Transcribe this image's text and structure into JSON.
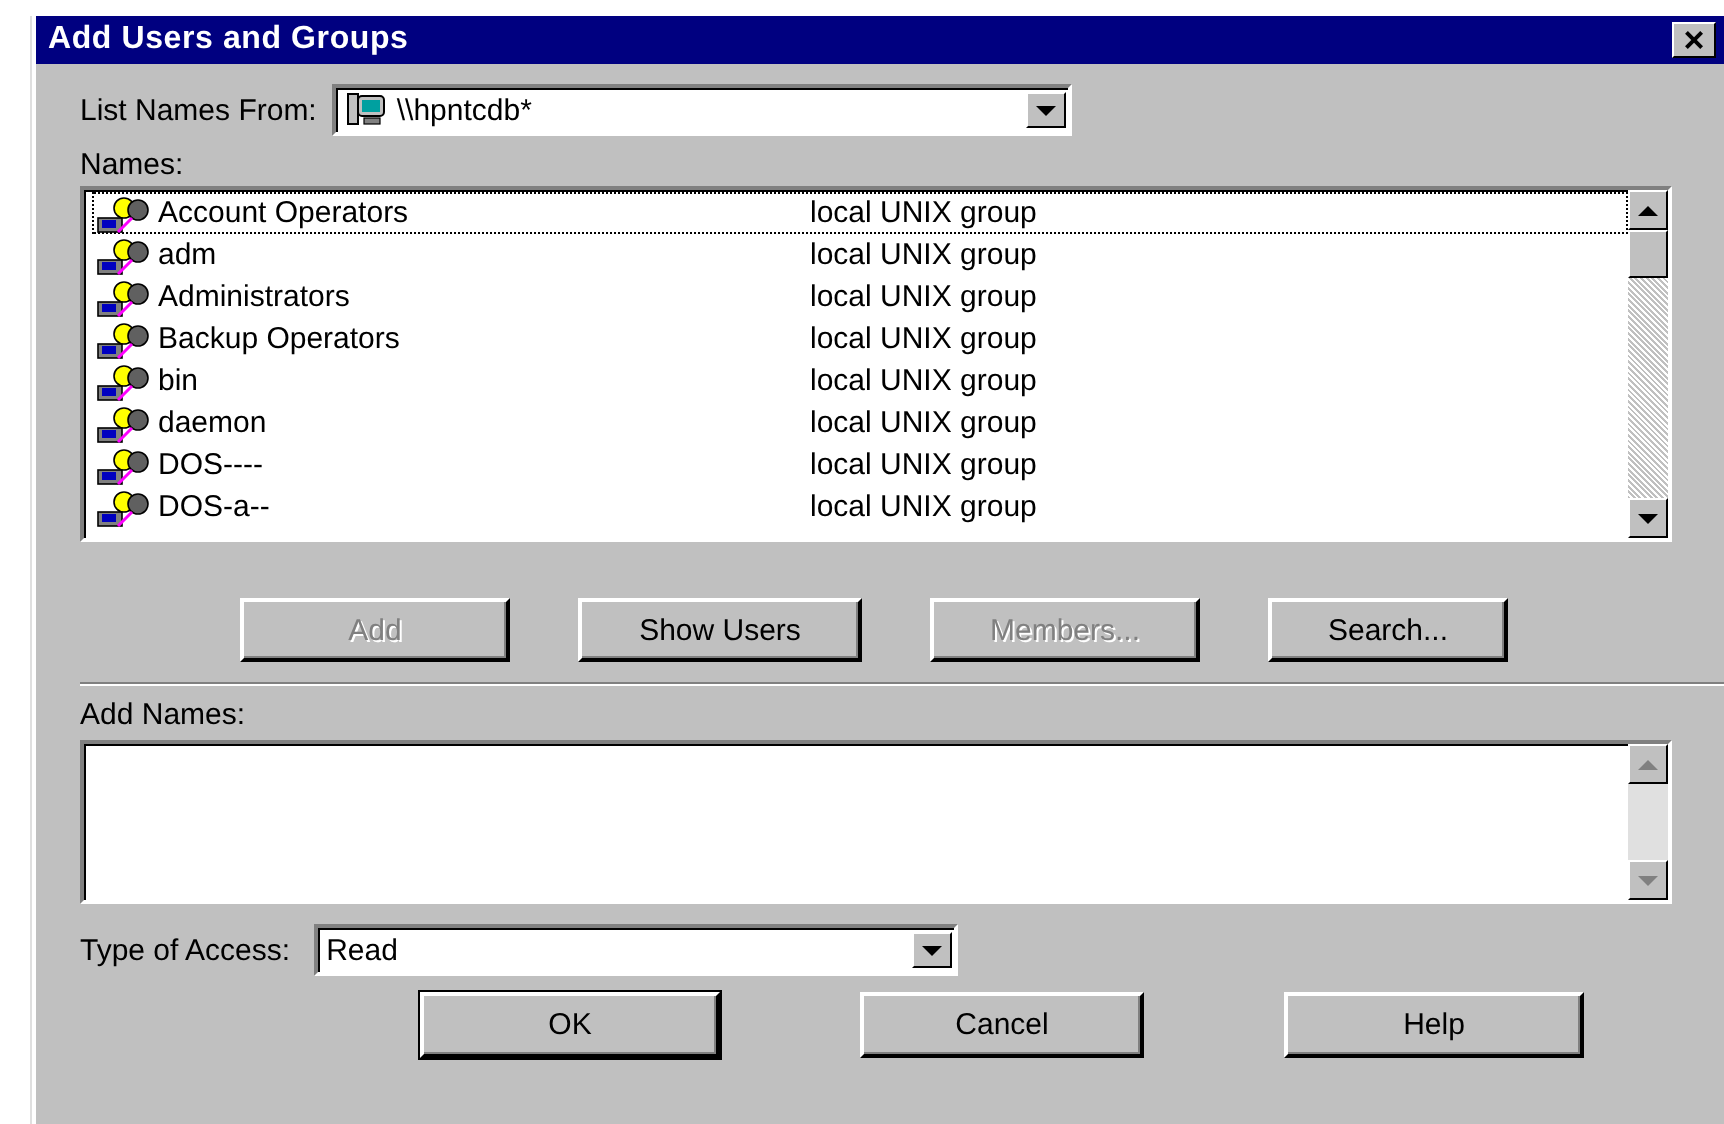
{
  "window": {
    "title": "Add Users and Groups",
    "close": "×"
  },
  "list_names_from": {
    "label": "List Names From:",
    "value": "\\\\hpntcdb*"
  },
  "names": {
    "label": "Names:",
    "rows": [
      {
        "name": "Account Operators",
        "type": "local UNIX group",
        "focused": true
      },
      {
        "name": "adm",
        "type": "local UNIX group",
        "focused": false
      },
      {
        "name": "Administrators",
        "type": "local UNIX group",
        "focused": false
      },
      {
        "name": "Backup Operators",
        "type": "local UNIX group",
        "focused": false
      },
      {
        "name": "bin",
        "type": "local UNIX group",
        "focused": false
      },
      {
        "name": "daemon",
        "type": "local UNIX group",
        "focused": false
      },
      {
        "name": "DOS----",
        "type": "local UNIX group",
        "focused": false
      },
      {
        "name": "DOS-a--",
        "type": "local UNIX group",
        "focused": false
      }
    ]
  },
  "list_buttons": [
    {
      "label": "Add",
      "disabled": true
    },
    {
      "label": "Show Users",
      "disabled": false
    },
    {
      "label": "Members...",
      "disabled": true
    },
    {
      "label": "Search...",
      "disabled": false
    }
  ],
  "add_names": {
    "label": "Add Names:"
  },
  "type_of_access": {
    "label": "Type of Access:",
    "value": "Read"
  },
  "buttons": [
    {
      "label": "OK",
      "default": true
    },
    {
      "label": "Cancel",
      "default": false
    },
    {
      "label": "Help",
      "default": false
    }
  ]
}
